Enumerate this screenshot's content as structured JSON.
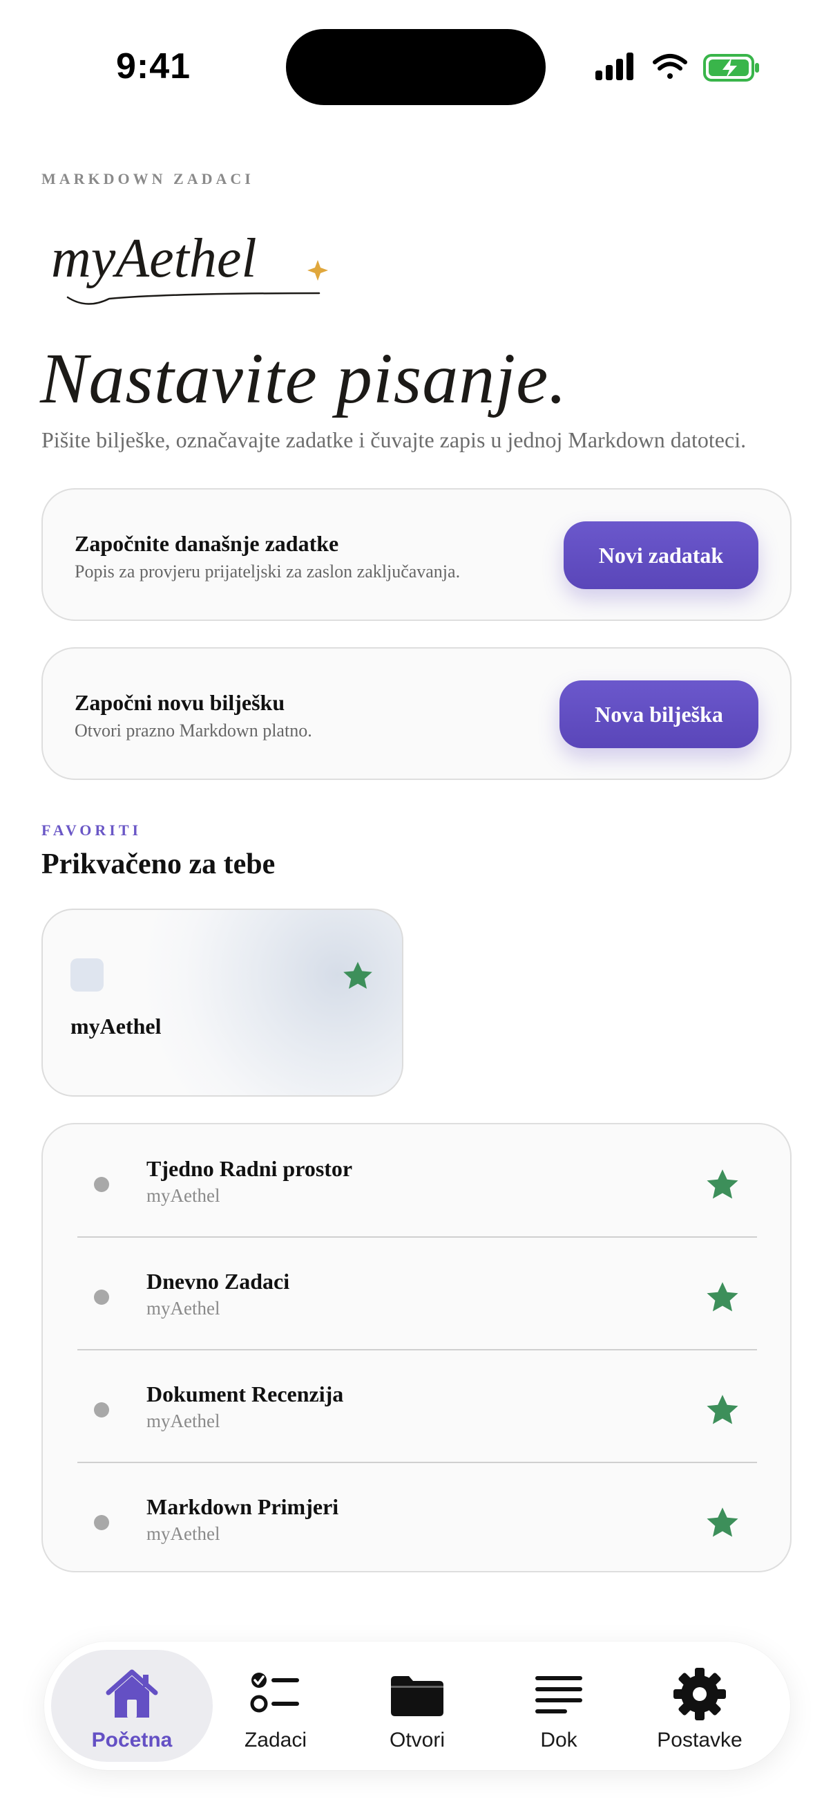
{
  "status_bar": {
    "time": "9:41",
    "icons": [
      "cellular-signal-icon",
      "wifi-icon",
      "battery-charging-icon"
    ]
  },
  "header": {
    "eyebrow": "MARKDOWN ZADACI",
    "logo_text": "myAethel",
    "title": "Nastavite pisanje.",
    "subtitle": "Pišite bilješke, označavajte zadatke i čuvajte zapis u jednoj Markdown datoteci."
  },
  "actions": [
    {
      "title": "Započnite današnje zadatke",
      "subtitle": "Popis za provjeru prijateljski za zaslon zaključavanja.",
      "button": "Novi zadatak"
    },
    {
      "title": "Započni novu bilješku",
      "subtitle": "Otvori prazno Markdown platno.",
      "button": "Nova bilješka"
    }
  ],
  "favorites": {
    "eyebrow": "FAVORITI",
    "title": "Prikvačeno za tebe",
    "pinned": {
      "name": "myAethel",
      "starred": true
    },
    "items": [
      {
        "title": "Tjedno Radni prostor",
        "subtitle": "myAethel",
        "starred": true
      },
      {
        "title": "Dnevno Zadaci",
        "subtitle": "myAethel",
        "starred": true
      },
      {
        "title": "Dokument Recenzija",
        "subtitle": "myAethel",
        "starred": true
      },
      {
        "title": "Markdown Primjeri",
        "subtitle": "myAethel",
        "starred": true
      }
    ]
  },
  "tabbar": {
    "active": "Početna",
    "tabs": [
      {
        "label": "Početna",
        "icon": "home-icon"
      },
      {
        "label": "Zadaci",
        "icon": "checklist-icon"
      },
      {
        "label": "Otvori",
        "icon": "folder-icon"
      },
      {
        "label": "Dok",
        "icon": "document-lines-icon"
      },
      {
        "label": "Postavke",
        "icon": "gear-icon"
      }
    ]
  },
  "colors": {
    "accent": "#6450c4",
    "star": "#3d8f5a",
    "muted": "#8a8a8a",
    "logo_sparkle": "#e0a73c"
  }
}
